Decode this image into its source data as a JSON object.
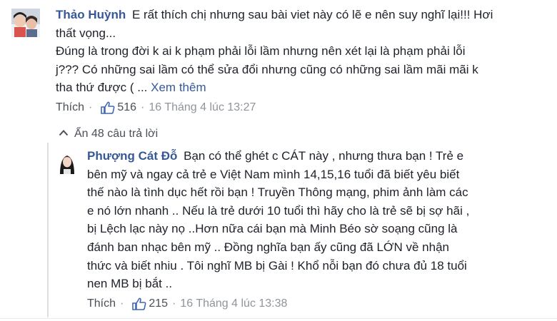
{
  "comment": {
    "author": "Thảo Huỳnh",
    "lines": [
      "E rất thích chị nhưng sau bài viet này có lẽ e nên suy nghĩ lại!!! Hơi",
      "thất vọng...",
      "Đúng là trong đời k ai k phạm phải lỗi lầm nhưng nên xét lại là phạm phải lỗi",
      "j??? Có những sai lầm có thể sửa đổi nhưng cũng có những sai lầm mãi mãi k"
    ],
    "last_line": "tha thứ được ( ...",
    "see_more": "Xem thêm",
    "like_label": "Thích",
    "like_count": "516",
    "separator": "·",
    "timestamp": "16 Tháng 4 lúc 13:27"
  },
  "replies_toggle": {
    "label": "Ẩn 48 câu trả lời",
    "icon": "chevron-up-icon"
  },
  "reply": {
    "author": "Phượng Cát Đỗ",
    "lines": [
      "Bạn có thể ghét c CÁT này , nhưng thưa bạn ! Trẻ e",
      "bên mỹ và ngay cả trẻ e Việt Nam mình 14,15,16 tuổi đã biết yêu biết",
      "thế nào là tình dục hết rồi bạn ! Truyền Thông mạng, phim ảnh làm các",
      "e nó lớn nhanh .. Nếu là trẻ dưới 10 tuổi thì hãy cho là trẻ sẽ bị sợ hãi ,",
      "bị Lệch lạc này nọ ..Hơn nữa cái bạn mà Minh Béo sờ soạng cũng là",
      "đánh ban nhạc bên mỹ .. Đồng nghĩa bạn ấy cũng đã LỚN về nhận",
      "thức và biết nhiu . Tôi nghĩ MB bị Gài ! Khổ nỗi bạn đó chưa đủ 18 tuổi",
      "nen MB bị bắt .."
    ],
    "like_label": "Thích",
    "like_count": "215",
    "separator": "·",
    "timestamp": "16 Tháng 4 lúc 13:38"
  },
  "colors": {
    "link": "#365899",
    "text": "#1d2129",
    "meta": "#90949c",
    "like_blue": "#4267b2"
  }
}
